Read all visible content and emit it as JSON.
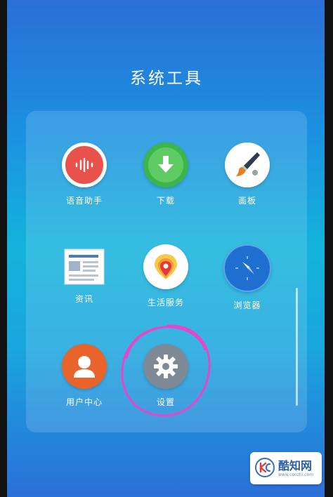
{
  "folder": {
    "title": "系统工具"
  },
  "apps": [
    {
      "label": "语音助手",
      "icon": "voice-wave-icon",
      "color": "#e9524a"
    },
    {
      "label": "下载",
      "icon": "download-arrow-icon",
      "color": "#3cb54a"
    },
    {
      "label": "画板",
      "icon": "paintbrush-icon",
      "color": "#ffffff"
    },
    {
      "label": "资讯",
      "icon": "news-icon",
      "color": "#ffffff"
    },
    {
      "label": "生活服务",
      "icon": "location-pin-icon",
      "color": "#ffffff"
    },
    {
      "label": "浏览器",
      "icon": "compass-icon",
      "color": "#1f6fd0"
    },
    {
      "label": "用户中心",
      "icon": "user-icon",
      "color": "#e8642a"
    },
    {
      "label": "设置",
      "icon": "gear-icon",
      "color": "#7d8a96"
    }
  ],
  "annotation": {
    "color": "#e646c9"
  },
  "watermark": {
    "text": "酷知网",
    "url": "www.coozhi.com"
  }
}
